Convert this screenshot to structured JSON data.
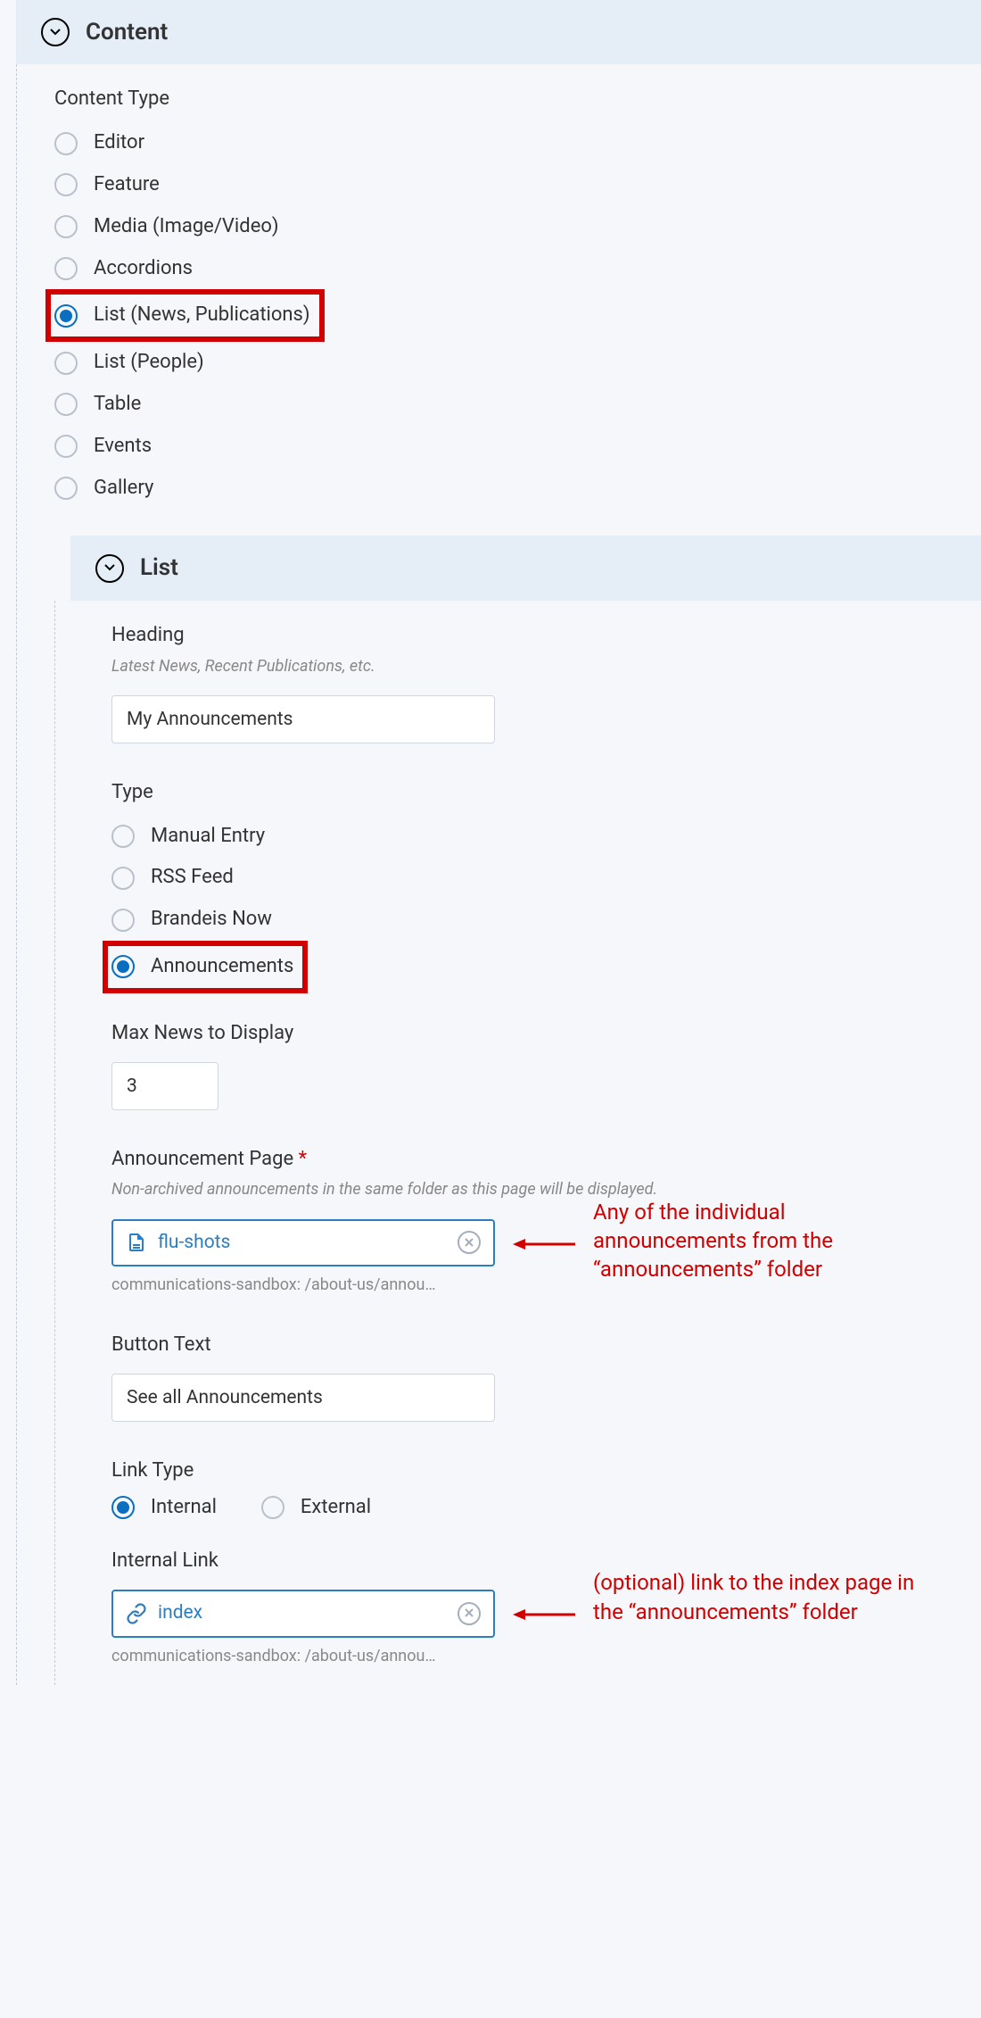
{
  "sections": {
    "content": {
      "title": "Content"
    },
    "list": {
      "title": "List"
    }
  },
  "contentType": {
    "label": "Content Type",
    "options": [
      "Editor",
      "Feature",
      "Media (Image/Video)",
      "Accordions",
      "List (News, Publications)",
      "List (People)",
      "Table",
      "Events",
      "Gallery"
    ],
    "selected": "List (News, Publications)"
  },
  "heading": {
    "label": "Heading",
    "help": "Latest News, Recent Publications, etc.",
    "value": "My Announcements"
  },
  "listType": {
    "label": "Type",
    "options": [
      "Manual Entry",
      "RSS Feed",
      "Brandeis Now",
      "Announcements"
    ],
    "selected": "Announcements"
  },
  "maxNews": {
    "label": "Max News to Display",
    "value": "3"
  },
  "announcementPage": {
    "label": "Announcement Page",
    "required": "*",
    "help": "Non-archived announcements in the same folder as this page will be displayed.",
    "value": "flu-shots",
    "path": "communications-sandbox: /about-us/annou…",
    "annotation": "Any of the individual announcements from the “announcements” folder"
  },
  "buttonText": {
    "label": "Button Text",
    "value": "See all Announcements"
  },
  "linkType": {
    "label": "Link Type",
    "options": [
      "Internal",
      "External"
    ],
    "selected": "Internal"
  },
  "internalLink": {
    "label": "Internal Link",
    "value": "index",
    "path": "communications-sandbox: /about-us/annou…",
    "annotation": "(optional) link to the index page in the “announcements” folder"
  }
}
